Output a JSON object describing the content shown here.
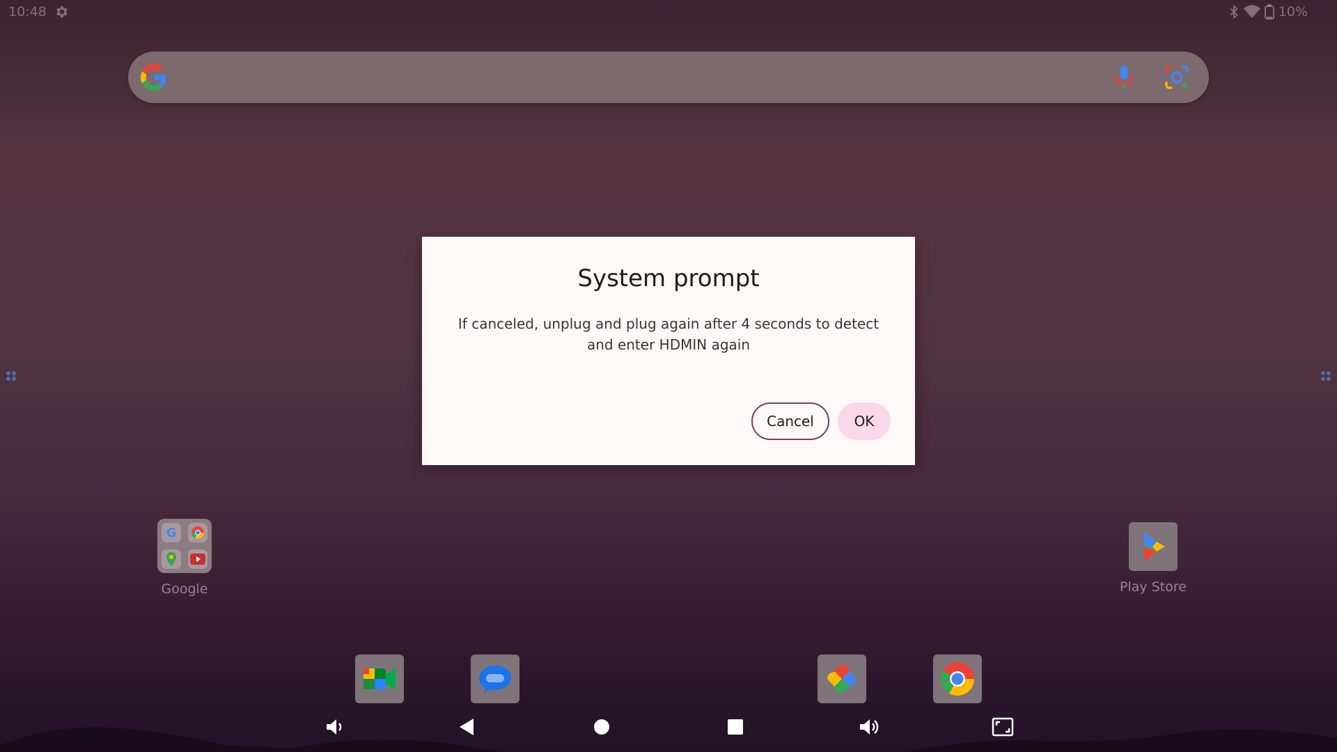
{
  "status_bar": {
    "time": "10:48",
    "battery": "10%",
    "icons": [
      "settings-icon",
      "bluetooth-icon",
      "wifi-icon",
      "battery-icon"
    ]
  },
  "search": {
    "icons": [
      "google-logo-icon",
      "microphone-icon",
      "google-lens-icon"
    ]
  },
  "home": {
    "folder_label": "Google",
    "folder_apps": [
      "google-icon",
      "chrome-icon",
      "maps-icon",
      "youtube-icon"
    ],
    "play_store_label": "Play Store"
  },
  "dock": {
    "apps": [
      "meet-icon",
      "messages-icon",
      "photos-icon",
      "chrome-icon"
    ]
  },
  "nav_bar": {
    "icons": [
      "volume-down-icon",
      "back-icon",
      "home-icon",
      "recents-icon",
      "volume-up-icon",
      "screenshot-icon"
    ]
  },
  "dialog": {
    "title": "System prompt",
    "message": "If canceled, unplug and plug again after 4 seconds to detect and enter HDMIN again",
    "cancel_label": "Cancel",
    "ok_label": "OK"
  },
  "colors": {
    "dialog_bg": "#fff8f8",
    "ok_button_bg": "#f9d8e8",
    "cancel_border": "#7a3d5e"
  }
}
